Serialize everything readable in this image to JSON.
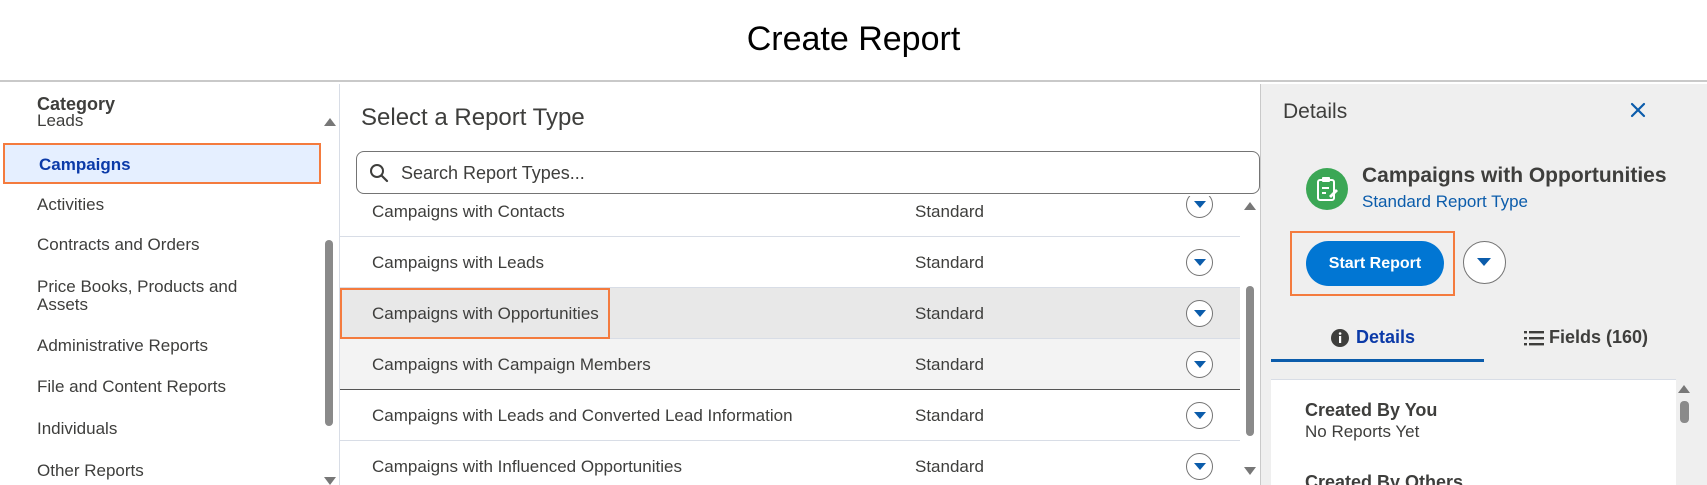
{
  "page": {
    "title": "Create Report"
  },
  "sidebar": {
    "header": "Category",
    "items": [
      {
        "label": "Leads"
      },
      {
        "label": "Campaigns",
        "selected": true
      },
      {
        "label": "Activities"
      },
      {
        "label": "Contracts and Orders"
      },
      {
        "label": "Price Books, Products and Assets"
      },
      {
        "label": "Administrative Reports"
      },
      {
        "label": "File and Content Reports"
      },
      {
        "label": "Individuals"
      },
      {
        "label": "Other Reports"
      }
    ]
  },
  "main": {
    "heading": "Select a Report Type",
    "search": {
      "placeholder": "Search Report Types...",
      "value": ""
    },
    "report_types": [
      {
        "name": "Campaigns with Contacts",
        "type": "Standard"
      },
      {
        "name": "Campaigns with Leads",
        "type": "Standard"
      },
      {
        "name": "Campaigns with Opportunities",
        "type": "Standard",
        "selected": true
      },
      {
        "name": "Campaigns with Campaign Members",
        "type": "Standard"
      },
      {
        "name": "Campaigns with Leads and Converted Lead Information",
        "type": "Standard"
      },
      {
        "name": "Campaigns with Influenced Opportunities",
        "type": "Standard"
      }
    ]
  },
  "details": {
    "label": "Details",
    "report_type_name": "Campaigns with Opportunities",
    "report_type_kind": "Standard Report Type",
    "start_button": "Start Report",
    "tabs": [
      {
        "label": "Details",
        "active": true,
        "icon": "info-icon"
      },
      {
        "label": "Fields (160)",
        "active": false,
        "icon": "list-icon"
      }
    ],
    "created_by_you": "Created By You",
    "no_reports": "No Reports Yet",
    "created_by_others": "Created By Others"
  },
  "colors": {
    "accent": "#0176d3",
    "highlight_outline": "#f47b3e",
    "selected_bg": "#e5efff",
    "icon_green": "#3ba755",
    "link": "#0b5cab"
  }
}
